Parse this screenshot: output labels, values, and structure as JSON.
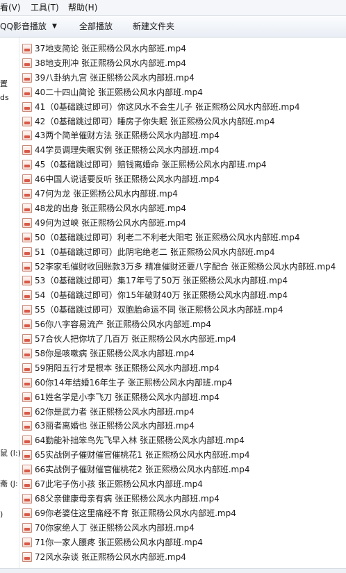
{
  "menubar": {
    "view": "看(V)",
    "tools": "工具(T)",
    "help": "帮助(H)"
  },
  "toolbar": {
    "play": "QQ影音播放",
    "play_all": "全部播放",
    "new_folder": "新建文件夹"
  },
  "sidebar": {
    "t1": "            ",
    "t1b": "置",
    "t2": "ds",
    "t3": "鼠 (I:)",
    "t4": "斋 (J:",
    "t5": ")"
  },
  "files": [
    "37地支简论   张正熙杨公风水内部班.mp4",
    "38地支刑冲  张正熙杨公风水内部班.mp4",
    "39八卦纳九宫   张正熙杨公风水内部班.mp4",
    "40二十四山简论   张正熙杨公风水内部班.mp4",
    "41（0基础跳过即可）你这风水不会生儿子  张正熙杨公风水内部班.mp4",
    "42（0基础跳过即可）睡房子你失眠  张正熙杨公风水内部班.mp4",
    "43两个简单催财方法  张正熙杨公风水内部班.mp4",
    "44学员调理失眠实例    张正熙杨公风水内部班.mp4",
    "45（0基础跳过即可）赔钱离婚命   张正熙杨公风水内部班.mp4",
    "46中国人说话要反听   张正熙杨公风水内部班.mp4",
    "47何为龙 张正熙杨公风水内部班.mp4",
    "48龙的出身  张正熙杨公风水内部班.mp4",
    "49何为过峡  张正熙杨公风水内部班.mp4",
    "50（0基础跳过即可）利老二不利老大阳宅   张正熙杨公风水内部班.mp4",
    "51（0基础跳过即可）此阴宅绝老二   张正熙杨公风水内部班.mp4",
    "52李家毛催财收回账款3万多 精准催财还要八字配合   张正熙杨公风水内部班.mp4",
    "53（0基础跳过即可）集17年亏了50万  张正熙杨公风水内部班.mp4",
    "54（0基础跳过即可）你15年破财40万  张正熙杨公风水内部班.mp4",
    "55（0基础跳过即可）双胞胎命运不同  张正熙杨公风水内部班.mp4",
    "56你八字容易流产   张正熙杨公风水内部班.mp4",
    "57合伙人把你坑了几百万   张正熙杨公风水内部班.mp4",
    "58你是咳嗽病  张正熙杨公风水内部班.mp4",
    "59阴阳五行才是根本  张正熙杨公风水内部班.mp4",
    "60你14年结婚16年生子    张正熙杨公风水内部班.mp4",
    "61姓名学是小李飞刀    张正熙杨公风水内部班.mp4",
    "62你是武力者   张正熙杨公风水内部班.mp4",
    "63丽者离婚也    张正熙杨公风水内部班.mp4",
    "64勤能补拙笨鸟先飞早入林    张正熙杨公风水内部班.mp4",
    "65实战例子催财催官催桃花1    张正熙杨公风水内部班.mp4",
    "66实战例子催财催官催桃花2    张正熙杨公风水内部班.mp4",
    "67此宅子伤小孩    张正熙杨公风水内部班.mp4",
    "68父亲健康母亲有病    张正熙杨公风水内部班.mp4",
    "69你老婆住这里痛经不育    张正熙杨公风水内部班.mp4",
    "70你家绝人丁    张正熙杨公风水内部班.mp4",
    "71你一家人腰疼    张正熙杨公风水内部班.mp4",
    "72风水杂谈   张正熙杨公风水内部班.mp4"
  ]
}
